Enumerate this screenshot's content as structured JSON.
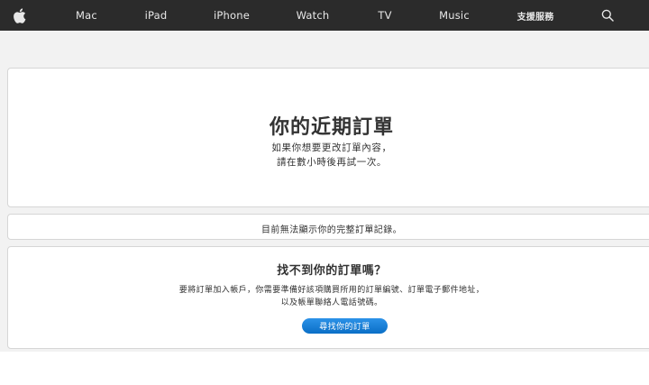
{
  "nav": {
    "apple_icon": "apple-logo-icon",
    "items": [
      {
        "label": "Mac"
      },
      {
        "label": "iPad"
      },
      {
        "label": "iPhone"
      },
      {
        "label": "Watch"
      },
      {
        "label": "TV"
      },
      {
        "label": "Music"
      },
      {
        "label": "支援服務"
      }
    ],
    "search_icon": "search-icon",
    "background_color": "#2b2b2b"
  },
  "recent_orders": {
    "title": "你的近期訂單",
    "line1": "如果你想要更改訂單內容，",
    "line2": "請在數小時後再試一次。"
  },
  "notice": {
    "text": "目前無法顯示你的完整訂單記錄。"
  },
  "find_order": {
    "title": "找不到你的訂單嗎？",
    "line1": "要將訂單加入帳戶，你需要準備好該項購買所用的訂單編號、訂單電子郵件地址，",
    "line2": "以及帳單聯絡人電話號碼。",
    "button_label": "尋找你的訂單",
    "button_color": "#0f7ad6"
  }
}
